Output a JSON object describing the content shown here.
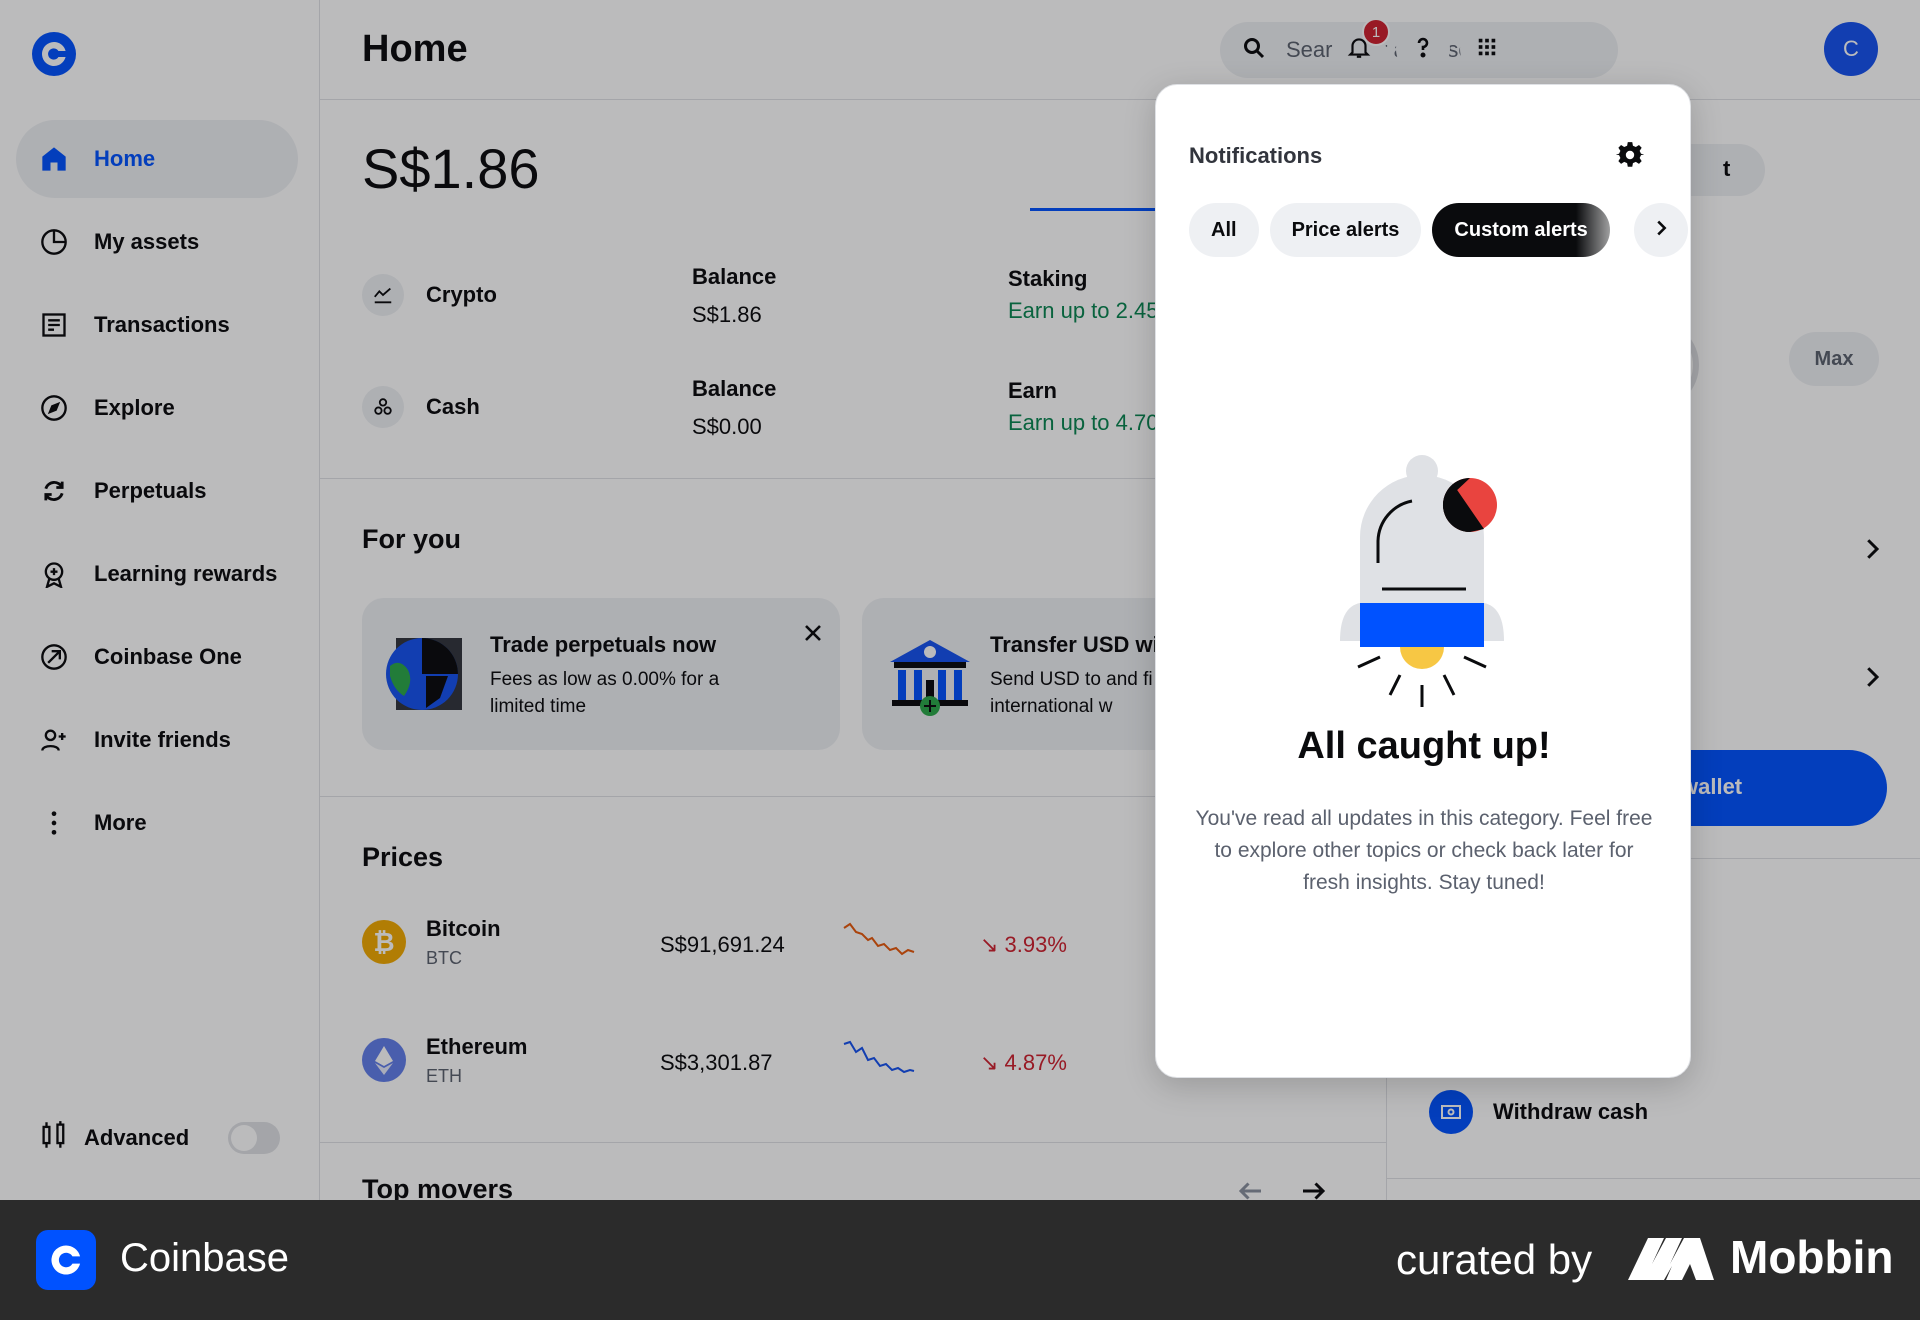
{
  "app": {
    "name": "Coinbase"
  },
  "sidebar": {
    "items": [
      {
        "label": "Home",
        "icon": "home-icon"
      },
      {
        "label": "My assets",
        "icon": "pie-chart-icon"
      },
      {
        "label": "Transactions",
        "icon": "receipt-icon"
      },
      {
        "label": "Explore",
        "icon": "compass-icon"
      },
      {
        "label": "Perpetuals",
        "icon": "refresh-icon"
      },
      {
        "label": "Learning rewards",
        "icon": "reward-icon"
      },
      {
        "label": "Coinbase One",
        "icon": "coinbase-one-icon"
      },
      {
        "label": "Invite friends",
        "icon": "add-user-icon"
      },
      {
        "label": "More",
        "icon": "more-vertical-icon"
      }
    ],
    "advanced_label": "Advanced",
    "advanced_on": false
  },
  "header": {
    "title": "Home",
    "search_placeholder": "Search for an asset",
    "notification_count": "1",
    "avatar_initial": "C"
  },
  "main": {
    "total_balance": "S$1.86",
    "balances": [
      {
        "name": "Crypto",
        "balance_label": "Balance",
        "balance": "S$1.86",
        "side_label": "Staking",
        "side_value": "Earn up to 2.45"
      },
      {
        "name": "Cash",
        "balance_label": "Balance",
        "balance": "S$0.00",
        "side_label": "Earn",
        "side_value": "Earn up to 4.70"
      }
    ],
    "for_you_title": "For you",
    "cards": [
      {
        "title": "Trade perpetuals now",
        "desc": "Fees as low as 0.00% for a limited time"
      },
      {
        "title": "Transfer USD wi",
        "desc": "Send USD to and fi via international w"
      }
    ],
    "prices_title": "Prices",
    "prices": [
      {
        "name": "Bitcoin",
        "symbol": "BTC",
        "price": "S$91,691.24",
        "change": "↘ 3.93%"
      },
      {
        "name": "Ethereum",
        "symbol": "ETH",
        "price": "S$3,301.87",
        "change": "↘ 4.87%"
      }
    ],
    "movers_title": "Top movers"
  },
  "right_panel": {
    "pill_fragment": "t",
    "max_label": "Max",
    "cta_label": "wallet",
    "withdraw_label": "Withdraw cash"
  },
  "notifications": {
    "title": "Notifications",
    "tabs": [
      "All",
      "Price alerts",
      "Custom alerts"
    ],
    "active_tab": "Custom alerts",
    "empty_title": "All caught up!",
    "empty_body": "You've read all updates in this category. Feel free to explore other topics or check back later for fresh insights. Stay tuned!"
  },
  "footer": {
    "brand": "Coinbase",
    "curated_by": "curated by",
    "curator": "Mobbin"
  },
  "colors": {
    "accent": "#0052ff",
    "positive": "#098551",
    "negative": "#cf202f"
  }
}
